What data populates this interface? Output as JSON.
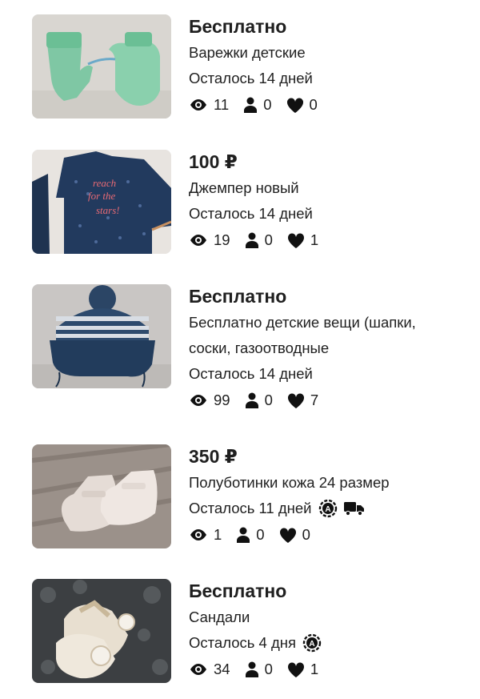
{
  "listings": [
    {
      "price": "Бесплатно",
      "title": "Варежки детские",
      "time_left": "Осталось 14 дней",
      "views": "11",
      "contacts": "0",
      "favorites": "0",
      "badges": []
    },
    {
      "price": "100 ₽",
      "title": "Джемпер новый",
      "time_left": "Осталось 14 дней",
      "views": "19",
      "contacts": "0",
      "favorites": "1",
      "badges": []
    },
    {
      "price": "Бесплатно",
      "title": "Бесплатно детские вещи (шапки,",
      "title_line2": "соски, газоотводные",
      "time_left": "Осталось 14 дней",
      "views": "99",
      "contacts": "0",
      "favorites": "7",
      "badges": []
    },
    {
      "price": "350 ₽",
      "title": "Полуботинки кожа 24 размер",
      "time_left": "Осталось 11 дней",
      "views": "1",
      "contacts": "0",
      "favorites": "0",
      "badges": [
        "auto-renew-icon",
        "delivery-truck-icon"
      ]
    },
    {
      "price": "Бесплатно",
      "title": "Сандали",
      "time_left": "Осталось 4 дня",
      "views": "34",
      "contacts": "0",
      "favorites": "1",
      "badges": [
        "auto-renew-icon"
      ]
    }
  ],
  "icons": {
    "views": "eye-icon",
    "contacts": "person-icon",
    "favorites": "heart-icon"
  },
  "colors": {
    "text": "#1f1f1f",
    "icon": "#111111"
  }
}
